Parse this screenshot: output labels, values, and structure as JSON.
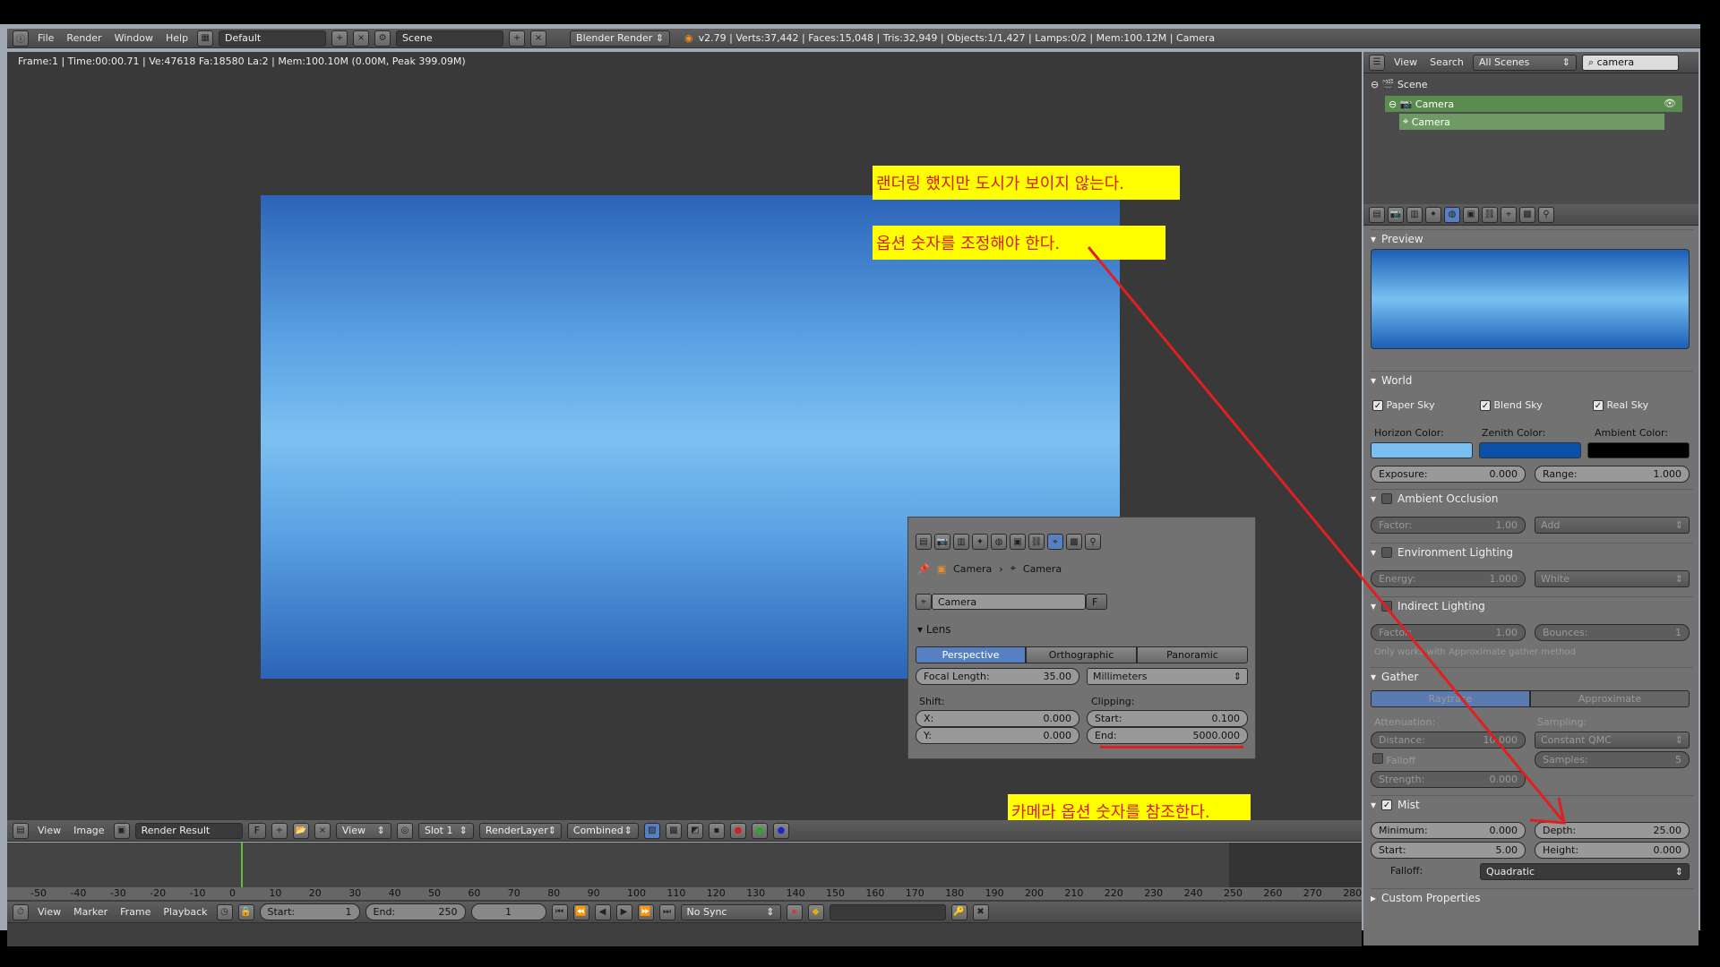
{
  "top_header": {
    "menus": [
      "File",
      "Render",
      "Window",
      "Help"
    ],
    "layout": "Default",
    "scene": "Scene",
    "engine": "Blender Render",
    "stats": "v2.79 | Verts:37,442 | Faces:15,048 | Tris:32,949 | Objects:1/1,427 | Lamps:0/2 | Mem:100.12M | Camera"
  },
  "render_view": {
    "frame_info": "Frame:1 | Time:00:00.71 | Ve:47618 Fa:18580 La:2 | Mem:100.10M (0.00M, Peak 399.09M)"
  },
  "annotations": {
    "note1": "랜더링 했지만 도시가 보이지 않는다.",
    "note2": "옵션 숫자를 조정해야 한다.",
    "note3": "카메라 옵션 숫자를 참조한다."
  },
  "camera_panel": {
    "breadcrumb": [
      "Camera",
      "Camera"
    ],
    "datablock": "Camera",
    "f_label": "F",
    "lens_title": "Lens",
    "lens_types": [
      "Perspective",
      "Orthographic",
      "Panoramic"
    ],
    "focal_label": "Focal Length:",
    "focal_value": "35.00",
    "units": "Millimeters",
    "shift_label": "Shift:",
    "shift_x_label": "X:",
    "shift_x_value": "0.000",
    "shift_y_label": "Y:",
    "shift_y_value": "0.000",
    "clip_label": "Clipping:",
    "clip_start_label": "Start:",
    "clip_start_value": "0.100",
    "clip_end_label": "End:",
    "clip_end_value": "5000.000"
  },
  "image_header": {
    "menus": [
      "View",
      "Image"
    ],
    "image": "Render Result",
    "f_label": "F",
    "view": "View",
    "slot": "Slot 1",
    "layer": "RenderLayer",
    "pass": "Combined"
  },
  "timeline": {
    "ticks": [
      "-50",
      "-40",
      "-30",
      "-20",
      "-10",
      "0",
      "10",
      "20",
      "30",
      "40",
      "50",
      "60",
      "70",
      "80",
      "90",
      "100",
      "110",
      "120",
      "130",
      "140",
      "150",
      "160",
      "170",
      "180",
      "190",
      "200",
      "210",
      "220",
      "230",
      "240",
      "250",
      "260",
      "270",
      "280"
    ],
    "menus": [
      "View",
      "Marker",
      "Frame",
      "Playback"
    ],
    "start_label": "Start:",
    "start_value": "1",
    "end_label": "End:",
    "end_value": "250",
    "current": "1",
    "sync": "No Sync"
  },
  "outliner": {
    "menus": [
      "View",
      "Search"
    ],
    "filter": "All Scenes",
    "search": "camera",
    "items": [
      "Scene",
      "Camera",
      "Camera"
    ]
  },
  "world_props": {
    "preview_title": "Preview",
    "world_title": "World",
    "paper_sky": "Paper Sky",
    "blend_sky": "Blend Sky",
    "real_sky": "Real Sky",
    "horizon_label": "Horizon Color:",
    "zenith_label": "Zenith Color:",
    "ambient_label": "Ambient Color:",
    "horizon_color": "#79c0f2",
    "zenith_color": "#0a4fa8",
    "ambient_color": "#000000",
    "exposure_label": "Exposure:",
    "exposure_value": "0.000",
    "range_label": "Range:",
    "range_value": "1.000",
    "ao_title": "Ambient Occlusion",
    "ao_factor_label": "Factor:",
    "ao_factor_value": "1.00",
    "ao_mode": "Add",
    "env_title": "Environment Lighting",
    "env_energy_label": "Energy:",
    "env_energy_value": "1.000",
    "env_mode": "White",
    "ind_title": "Indirect Lighting",
    "ind_factor_label": "Factor:",
    "ind_factor_value": "1.00",
    "ind_bounces_label": "Bounces:",
    "ind_bounces_value": "1",
    "ind_note": "Only works with Approximate gather method",
    "gather_title": "Gather",
    "gather_modes": [
      "Raytrace",
      "Approximate"
    ],
    "attenuation_label": "Attenuation:",
    "sampling_label": "Sampling:",
    "distance_label": "Distance:",
    "distance_value": "10.000",
    "sampling_mode": "Constant QMC",
    "falloff_cb": "Falloff",
    "samples_label": "Samples:",
    "samples_value": "5",
    "strength_label": "Strength:",
    "strength_value": "0.000",
    "mist_title": "Mist",
    "min_label": "Minimum:",
    "min_value": "0.000",
    "depth_label": "Depth:",
    "depth_value": "25.00",
    "start_label": "Start:",
    "start_value": "5.00",
    "height_label": "Height:",
    "height_value": "0.000",
    "falloff_label": "Falloff:",
    "falloff_value": "Quadratic",
    "custom_title": "Custom Properties"
  }
}
